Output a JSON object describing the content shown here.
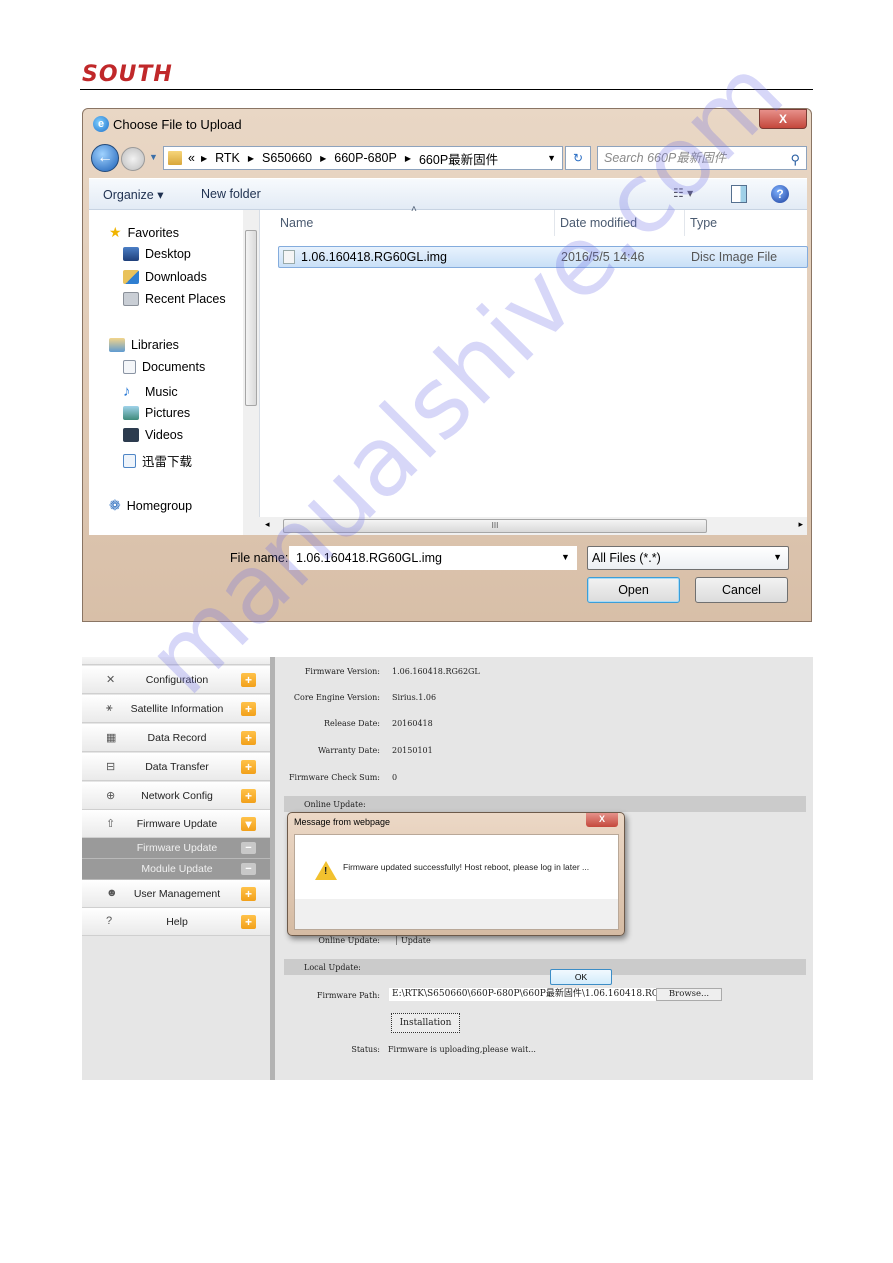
{
  "header": {
    "logo": "SOUTH"
  },
  "file_dialog": {
    "title": "Choose File to Upload",
    "close_label": "X",
    "breadcrumb": {
      "overflow": "«",
      "parts": [
        "RTK",
        "S650660",
        "660P-680P",
        "660P最新固件"
      ]
    },
    "search_placeholder": "Search 660P最新固件",
    "toolbar": {
      "organize": "Organize ▾",
      "new_folder": "New folder",
      "views": "☷ ▾",
      "help": "?"
    },
    "nav": {
      "favorites": "Favorites",
      "desktop": "Desktop",
      "downloads": "Downloads",
      "recent_places": "Recent Places",
      "libraries": "Libraries",
      "documents": "Documents",
      "music": "Music",
      "pictures": "Pictures",
      "videos": "Videos",
      "xunlei": "迅雷下载",
      "homegroup": "Homegroup"
    },
    "columns": {
      "name": "Name",
      "date_modified": "Date modified",
      "type": "Type"
    },
    "files": [
      {
        "name": "1.06.160418.RG60GL.img",
        "date_modified": "2016/5/5 14:46",
        "type": "Disc Image File"
      }
    ],
    "scroll_grip": "III",
    "file_name_label": "File name:",
    "file_name_value": "1.06.160418.RG60GL.img",
    "file_type": "All Files (*.*)",
    "open_label": "Open",
    "cancel_label": "Cancel"
  },
  "web_ui": {
    "sidebar": [
      {
        "icon": "✕",
        "label": "Configuration",
        "state": "+"
      },
      {
        "icon": "⚹",
        "label": "Satellite Information",
        "state": "+"
      },
      {
        "icon": "▦",
        "label": "Data Record",
        "state": "+"
      },
      {
        "icon": "⊟",
        "label": "Data Transfer",
        "state": "+"
      },
      {
        "icon": "⊕",
        "label": "Network Config",
        "state": "+"
      },
      {
        "icon": "⇧",
        "label": "Firmware Update",
        "state": "▾"
      }
    ],
    "sidebar_sub": [
      {
        "label": "Firmware Update",
        "state": "−"
      },
      {
        "label": "Module Update",
        "state": "−"
      }
    ],
    "sidebar_after": [
      {
        "icon": "☻",
        "label": "User Management",
        "state": "+"
      },
      {
        "icon": "?",
        "label": "Help",
        "state": "+"
      }
    ],
    "info": [
      {
        "key": "Firmware Version:",
        "value": "1.06.160418.RG62GL"
      },
      {
        "key": "Core Engine Version:",
        "value": "Sirius.1.06"
      },
      {
        "key": "Release Date:",
        "value": "20160418"
      },
      {
        "key": "Warranty Date:",
        "value": "20150101"
      },
      {
        "key": "Firmware Check Sum:",
        "value": "0"
      }
    ],
    "online_update_header": "Online Update:",
    "online_update_label": "Online Update:",
    "online_update_button": "Update",
    "local_update_header": "Local Update:",
    "firmware_path_label": "Firmware Path:",
    "firmware_path_value": "E:\\RTK\\S650660\\660P-680P\\660P最新固件\\1.06.160418.RG",
    "browse_label": "Browse...",
    "install_label": "Installation",
    "status_label": "Status:",
    "status_value": "Firmware is uploading,please wait..."
  },
  "message_box": {
    "title": "Message from webpage",
    "close_label": "X",
    "text": "Firmware updated successfully! Host reboot, please log in later ...",
    "ok_label": "OK"
  },
  "watermark": "manualshive.com"
}
